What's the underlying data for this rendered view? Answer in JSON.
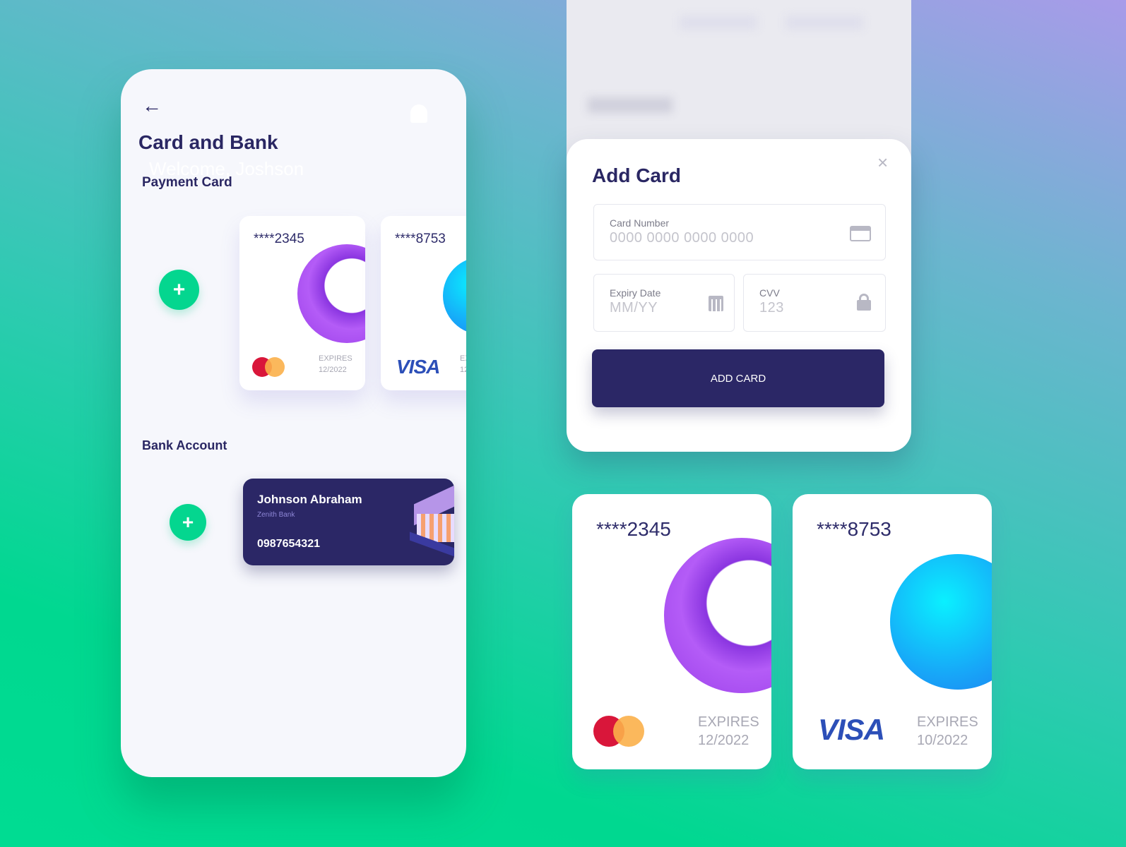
{
  "left_screen": {
    "title": "Card and Bank",
    "welcome": "Welcome, Joshson",
    "payment_section": "Payment Card",
    "bank_section": "Bank Account",
    "cards": [
      {
        "number": "****2345",
        "expires_label": "EXPIRES",
        "expiry": "12/2022",
        "brand": "mastercard"
      },
      {
        "number": "****8753",
        "expires_label": "EX",
        "expiry": "12",
        "brand": "VISA"
      }
    ],
    "bank": {
      "name": "Johnson Abraham",
      "bank_name": "Zenith Bank",
      "account_number": "0987654321"
    }
  },
  "add_card_modal": {
    "title": "Add Card",
    "card_number_label": "Card Number",
    "card_number_placeholder": "0000 0000 0000 0000",
    "expiry_label": "Expiry Date",
    "expiry_placeholder": "MM/YY",
    "cvv_label": "CVV",
    "cvv_placeholder": "123",
    "button": "ADD CARD"
  },
  "showcase_cards": [
    {
      "number": "****2345",
      "expires_label": "EXPIRES",
      "expiry": "12/2022",
      "brand": "mastercard"
    },
    {
      "number": "****8753",
      "expires_label": "EXPIRES",
      "expiry": "10/2022",
      "brand": "VISA"
    }
  ],
  "colors": {
    "navy": "#2a2763",
    "green": "#04d68f",
    "purple": "#b45cf7",
    "blue": "#17a8f8"
  }
}
